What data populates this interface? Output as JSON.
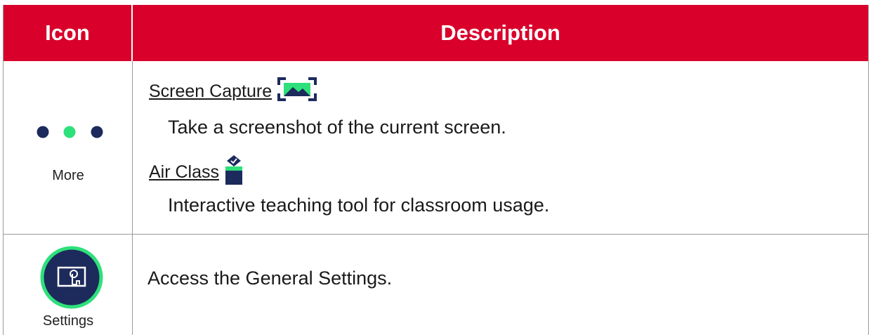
{
  "header": {
    "icon_col": "Icon",
    "desc_col": "Description"
  },
  "rows": [
    {
      "icon_label": "More",
      "icon_name": "more-dots-icon",
      "items": [
        {
          "title": "Screen Capture",
          "icon": "screen-capture-icon",
          "description": "Take a screenshot of the current screen."
        },
        {
          "title": "Air Class",
          "icon": "air-class-icon",
          "description": "Interactive teaching tool for classroom usage."
        }
      ]
    },
    {
      "icon_label": "Settings",
      "icon_name": "settings-icon",
      "description": "Access the General Settings."
    }
  ],
  "colors": {
    "header_bg": "#d9002b",
    "accent_green": "#2ee07a",
    "navy": "#1c2a5c"
  }
}
